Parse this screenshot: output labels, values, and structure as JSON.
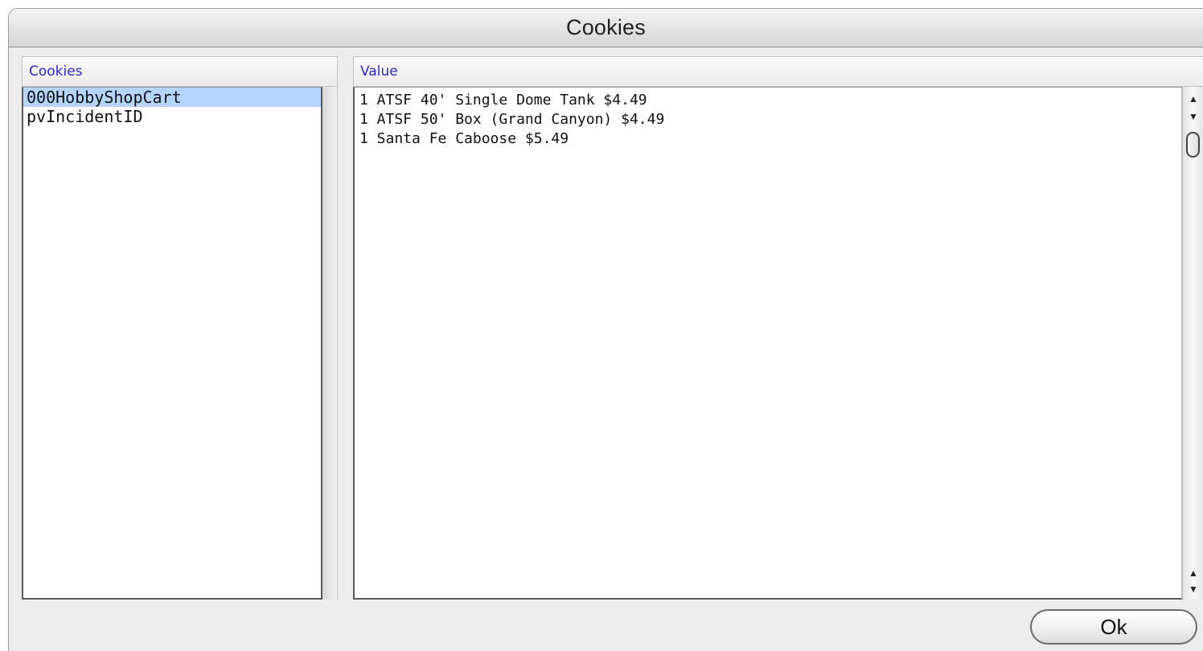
{
  "window": {
    "title": "Cookies"
  },
  "cookies_pane": {
    "header": "Cookies",
    "items": [
      {
        "label": "000HobbyShopCart",
        "selected": true
      },
      {
        "label": "pvIncidentID",
        "selected": false
      }
    ]
  },
  "value_pane": {
    "header": "Value",
    "lines": [
      "1 ATSF 40' Single Dome Tank $4.49",
      "1 ATSF 50' Box (Grand Canyon) $4.49",
      "1 Santa Fe Caboose $5.49"
    ]
  },
  "scrollbar": {
    "up_arrow": "▲",
    "down_arrow": "▼"
  },
  "buttons": {
    "ok_label": "Ok"
  },
  "colors": {
    "selection": "#b5d5ff",
    "header_text": "#2a2acc"
  }
}
